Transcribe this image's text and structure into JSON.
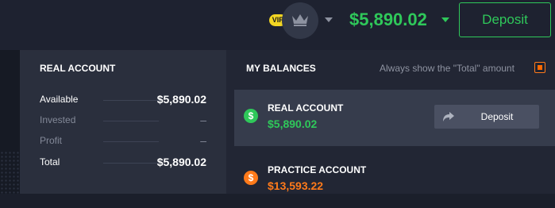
{
  "header": {
    "vip_label": "VIP",
    "crown_icon": "crown-icon",
    "balance": "$5,890.02",
    "deposit_label": "Deposit"
  },
  "real_summary": {
    "title": "REAL ACCOUNT",
    "rows": [
      {
        "label": "Available",
        "value": "$5,890.02"
      },
      {
        "label": "Invested",
        "value": "–"
      },
      {
        "label": "Profit",
        "value": "–"
      },
      {
        "label": "Total",
        "value": "$5,890.02"
      }
    ]
  },
  "balances": {
    "title": "MY BALANCES",
    "always_show_total_label": "Always show the \"Total\" amount",
    "always_show_total_checked": true,
    "accounts": [
      {
        "name": "REAL ACCOUNT",
        "balance": "$5,890.02",
        "icon": "dollar-coin-icon",
        "deposit_label": "Deposit"
      },
      {
        "name": "PRACTICE ACCOUNT",
        "balance": "$13,593.22",
        "icon": "dollar-coin-icon"
      }
    ]
  },
  "colors": {
    "green": "#2fc85a",
    "orange": "#ff7a1a",
    "vip_yellow": "#f3d623",
    "background": "#1b1f2b"
  }
}
